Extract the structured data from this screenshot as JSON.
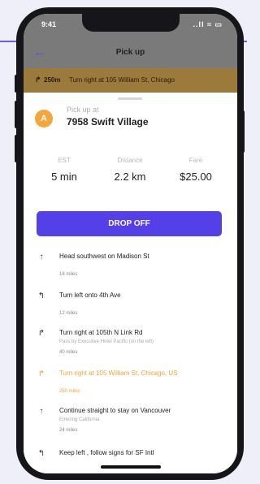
{
  "status_bar": {
    "time": "9:41",
    "icons": "..ll ≈ ▭"
  },
  "nav": {
    "back_icon": "arrow-left-icon",
    "title": "Pick up"
  },
  "turn_banner": {
    "icon": "turn-right-icon",
    "distance": "250m",
    "instruction": "Turn right at 105 William St, Chicago"
  },
  "pickup": {
    "avatar_letter": "A",
    "label": "Pick up at",
    "address": "7958 Swift Village"
  },
  "stats": [
    {
      "label": "EST",
      "value": "5 min"
    },
    {
      "label": "Distance",
      "value": "2.2 km"
    },
    {
      "label": "Fare",
      "value": "$25.00"
    }
  ],
  "drop_off_button": "DROP OFF",
  "steps": [
    {
      "icon": "straight-arrow-icon",
      "instruction": "Head southwest on Madison St",
      "sub": "",
      "miles": "18 miles",
      "active": false
    },
    {
      "icon": "turn-left-icon",
      "instruction": "Turn left onto 4th Ave",
      "sub": "",
      "miles": "12 miles",
      "active": false
    },
    {
      "icon": "turn-right-icon",
      "instruction": "Turn right at 105th N Link Rd",
      "sub": "Pass by Executive Hotel Pacific (on the left)",
      "miles": "40 miles",
      "active": false
    },
    {
      "icon": "turn-right-icon",
      "instruction": "Turn right at 105 William St, Chicago, US",
      "sub": "",
      "miles": "250 miles",
      "active": true
    },
    {
      "icon": "straight-arrow-icon",
      "instruction": "Continue straight to stay on Vancouver",
      "sub": "Entering California",
      "miles": "24 miles",
      "active": false
    },
    {
      "icon": "keep-left-icon",
      "instruction": "Keep left , follow signs for SF Intl",
      "sub": "",
      "miles": "",
      "active": false
    }
  ],
  "colors": {
    "accent": "#5340e8",
    "active_step": "#f3a63a",
    "banner": "#9c7a3b"
  }
}
